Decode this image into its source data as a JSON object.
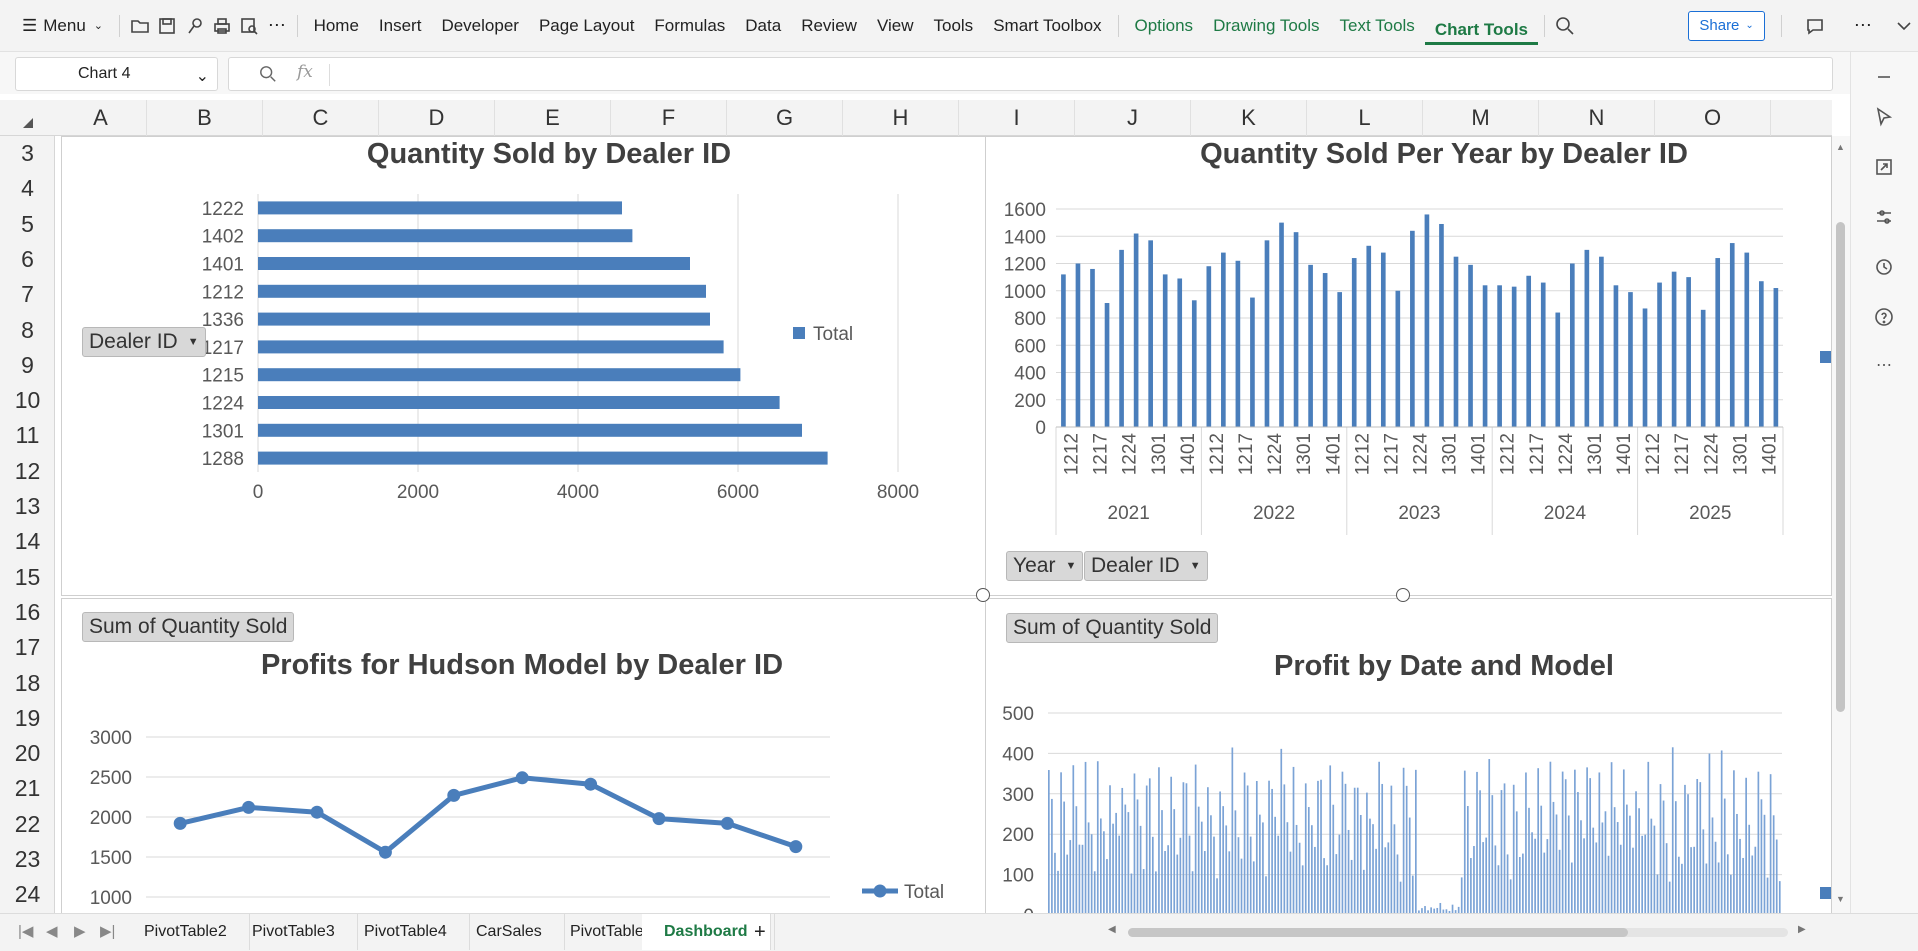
{
  "menubar": {
    "menu_label": "Menu",
    "tabs": [
      "Home",
      "Insert",
      "Developer",
      "Page Layout",
      "Formulas",
      "Data",
      "Review",
      "View",
      "Tools",
      "Smart Toolbox"
    ],
    "context_tabs": [
      "Options",
      "Drawing Tools",
      "Text Tools"
    ],
    "active_tab": "Chart Tools",
    "share_label": "Share",
    "icons": [
      "open-folder-icon",
      "save-icon",
      "format-painter-icon",
      "print-icon",
      "print-preview-icon",
      "more-icon",
      "search-icon",
      "comment-icon",
      "overflow-icon",
      "collapse-icon"
    ]
  },
  "formula": {
    "name_box": "Chart 4",
    "fx_symbol": "fx",
    "content": ""
  },
  "columns": [
    "A",
    "B",
    "C",
    "D",
    "E",
    "F",
    "G",
    "H",
    "I",
    "J",
    "K",
    "L",
    "M",
    "N",
    "O"
  ],
  "rows": [
    "3",
    "4",
    "5",
    "6",
    "7",
    "8",
    "9",
    "10",
    "11",
    "12",
    "13",
    "14",
    "15",
    "16",
    "17",
    "18",
    "19",
    "20",
    "21",
    "22",
    "23",
    "24"
  ],
  "charts": {
    "dealer_bar": {
      "field_button": "Dealer ID",
      "legend": "Total"
    },
    "yearly": {
      "field_buttons": [
        "Year",
        "Dealer ID"
      ]
    },
    "hudson": {
      "field_button": "Sum of Quantity Sold",
      "legend": "Total"
    },
    "profit": {
      "field_button": "Sum of Quantity Sold"
    }
  },
  "chart_data": [
    {
      "type": "bar",
      "orientation": "horizontal",
      "title": "Quantity Sold by Dealer ID",
      "categories": [
        "1222",
        "1402",
        "1401",
        "1212",
        "1336",
        "1217",
        "1215",
        "1224",
        "1301",
        "1288"
      ],
      "values": [
        4550,
        4680,
        5400,
        5600,
        5650,
        5820,
        6030,
        6520,
        6800,
        7120
      ],
      "xlim": [
        0,
        8000
      ],
      "xticks": [
        0,
        2000,
        4000,
        6000,
        8000
      ],
      "series": [
        {
          "name": "Total",
          "color": "#4a7ebb"
        }
      ],
      "legend_position": "right",
      "grid": true
    },
    {
      "type": "bar",
      "title": "Quantity Sold Per Year by Dealer ID",
      "groups": [
        "2021",
        "2022",
        "2023",
        "2024",
        "2025"
      ],
      "group_tick_labels": [
        "1212",
        "1217",
        "1224",
        "1301",
        "1401"
      ],
      "values": [
        [
          1120,
          1200,
          1160,
          910,
          1300,
          1420,
          1370,
          1120,
          1090,
          930
        ],
        [
          1180,
          1280,
          1220,
          950,
          1370,
          1500,
          1430,
          1190,
          1130,
          990
        ],
        [
          1240,
          1330,
          1280,
          1000,
          1440,
          1560,
          1490,
          1250,
          1190,
          1040
        ],
        [
          1040,
          1030,
          1110,
          1060,
          840,
          1200,
          1300,
          1250,
          1040,
          990
        ],
        [
          870,
          1060,
          1140,
          1100,
          860,
          1240,
          1350,
          1280,
          1070,
          1020
        ]
      ],
      "ylim": [
        0,
        1600
      ],
      "yticks": [
        0,
        200,
        400,
        600,
        800,
        1000,
        1200,
        1400,
        1600
      ],
      "color": "#4a7ebb",
      "grid": true
    },
    {
      "type": "line",
      "title": "Profits for Hudson Model by Dealer ID",
      "values": [
        1920,
        2120,
        2060,
        1560,
        2270,
        2490,
        2410,
        1980,
        1920,
        1630
      ],
      "yticks": [
        1000,
        1500,
        2000,
        2500,
        3000
      ],
      "ylim": [
        1000,
        3000
      ],
      "series": [
        {
          "name": "Total",
          "color": "#4a7ebb"
        }
      ],
      "legend_position": "right",
      "grid": true
    },
    {
      "type": "bar",
      "title": "Profit by Date and Model",
      "yticks": [
        0,
        100,
        200,
        300,
        400,
        500
      ],
      "ylim": [
        0,
        500
      ],
      "color": "#7ba3d6",
      "grid": true,
      "note_values": "dense series; ~0-440 per bar"
    }
  ]
}
